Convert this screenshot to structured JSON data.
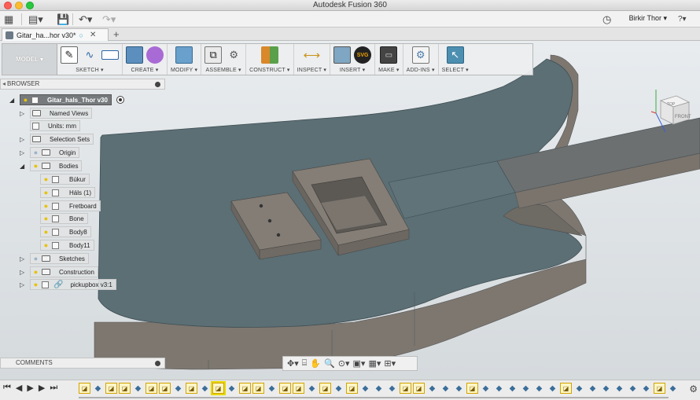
{
  "window": {
    "title": "Autodesk Fusion 360"
  },
  "appbar": {
    "user": "Birkir Thor ▾",
    "help": "?▾"
  },
  "tab": {
    "label": "Gitar_ha...hor v30*"
  },
  "toolbar": {
    "workspace": "MODEL ▾",
    "groups": [
      {
        "label": "SKETCH ▾"
      },
      {
        "label": "CREATE ▾"
      },
      {
        "label": "MODIFY ▾"
      },
      {
        "label": "ASSEMBLE ▾"
      },
      {
        "label": "CONSTRUCT ▾"
      },
      {
        "label": "INSPECT ▾"
      },
      {
        "label": "INSERT ▾"
      },
      {
        "label": "MAKE ▾"
      },
      {
        "label": "ADD-INS ▾"
      },
      {
        "label": "SELECT ▾"
      }
    ],
    "insert_svg_label": "SVG"
  },
  "browser": {
    "title": "BROWSER",
    "root": "Gitar_hals_Thor v30",
    "items": [
      {
        "label": "Named Views"
      },
      {
        "label": "Units: mm"
      },
      {
        "label": "Selection Sets"
      },
      {
        "label": "Origin"
      },
      {
        "label": "Bodies"
      },
      {
        "label": "Búkur"
      },
      {
        "label": "Háls (1)"
      },
      {
        "label": "Fretboard"
      },
      {
        "label": "Bone"
      },
      {
        "label": "Body8"
      },
      {
        "label": "Body11"
      },
      {
        "label": "Sketches"
      },
      {
        "label": "Construction"
      },
      {
        "label": "pickupbox v3:1"
      }
    ]
  },
  "comments": {
    "title": "COMMENTS"
  },
  "viewcube": {
    "top": "TOP",
    "front": "FRONT"
  },
  "colors": {
    "body": "#5a6e74",
    "body_side": "#827c76",
    "selected_tool": "#4d8fb0"
  }
}
